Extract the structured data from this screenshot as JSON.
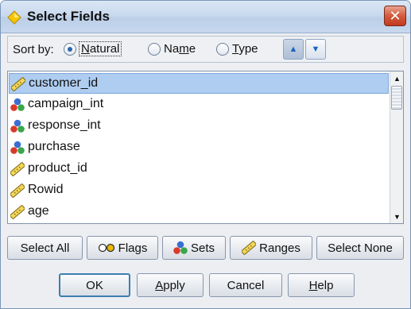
{
  "window": {
    "title": "Select Fields",
    "close_glyph": "✕"
  },
  "sort": {
    "label": "Sort by:",
    "options": [
      {
        "pre": "",
        "u": "N",
        "post": "atural",
        "selected": true
      },
      {
        "pre": "Na",
        "u": "m",
        "post": "e",
        "selected": false
      },
      {
        "pre": "",
        "u": "T",
        "post": "ype",
        "selected": false
      }
    ],
    "ascending_glyph": "▲",
    "descending_glyph": "▼"
  },
  "fields": [
    {
      "name": "customer_id",
      "icon": "range-icon",
      "selected": true
    },
    {
      "name": "campaign_int",
      "icon": "set-icon",
      "selected": false
    },
    {
      "name": "response_int",
      "icon": "set-icon",
      "selected": false
    },
    {
      "name": "purchase",
      "icon": "set-icon",
      "selected": false
    },
    {
      "name": "product_id",
      "icon": "range-icon",
      "selected": false
    },
    {
      "name": "Rowid",
      "icon": "range-icon",
      "selected": false
    },
    {
      "name": "age",
      "icon": "range-icon",
      "selected": false
    }
  ],
  "scrollbar": {
    "up_glyph": "▲",
    "down_glyph": "▼"
  },
  "selection_buttons": {
    "select_all": "Select All",
    "flags": "Flags",
    "sets": "Sets",
    "ranges": "Ranges",
    "select_none": "Select None"
  },
  "dialog_buttons": {
    "ok": "OK",
    "apply": {
      "u": "A",
      "rest": "pply"
    },
    "cancel": "Cancel",
    "help": {
      "u": "H",
      "rest": "elp"
    }
  },
  "colors": {
    "selection": "#aecdf0",
    "close_button": "#c23a1e",
    "accent": "#2d66b3"
  }
}
